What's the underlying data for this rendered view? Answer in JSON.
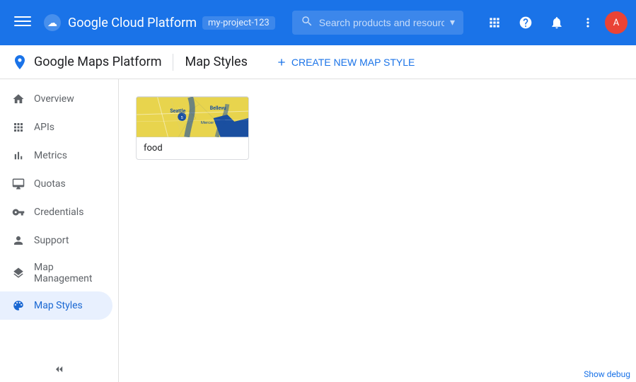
{
  "topbar": {
    "title": "Google Cloud Platform",
    "account_label": "my-project-123",
    "search_placeholder": "Search products and resources",
    "menu_icon": "☰",
    "apps_icon": "⊞",
    "help_icon": "?",
    "notification_icon": "🔔",
    "more_icon": "⋮",
    "avatar_letter": "A"
  },
  "subheader": {
    "app_title": "Google Maps Platform",
    "page_title": "Map Styles",
    "create_btn_label": "CREATE NEW MAP STYLE",
    "create_btn_icon": "+"
  },
  "sidebar": {
    "items": [
      {
        "id": "overview",
        "label": "Overview",
        "icon": "home"
      },
      {
        "id": "apis",
        "label": "APIs",
        "icon": "grid"
      },
      {
        "id": "metrics",
        "label": "Metrics",
        "icon": "bar_chart"
      },
      {
        "id": "quotas",
        "label": "Quotas",
        "icon": "monitor"
      },
      {
        "id": "credentials",
        "label": "Credentials",
        "icon": "key"
      },
      {
        "id": "support",
        "label": "Support",
        "icon": "person"
      },
      {
        "id": "map_management",
        "label": "Map Management",
        "icon": "layers"
      },
      {
        "id": "map_styles",
        "label": "Map Styles",
        "icon": "palette",
        "active": true
      }
    ],
    "collapse_label": "Collapse"
  },
  "main": {
    "cards": [
      {
        "id": "food-card",
        "label": "food"
      }
    ]
  },
  "debug_bar": {
    "label": "Show debug"
  }
}
